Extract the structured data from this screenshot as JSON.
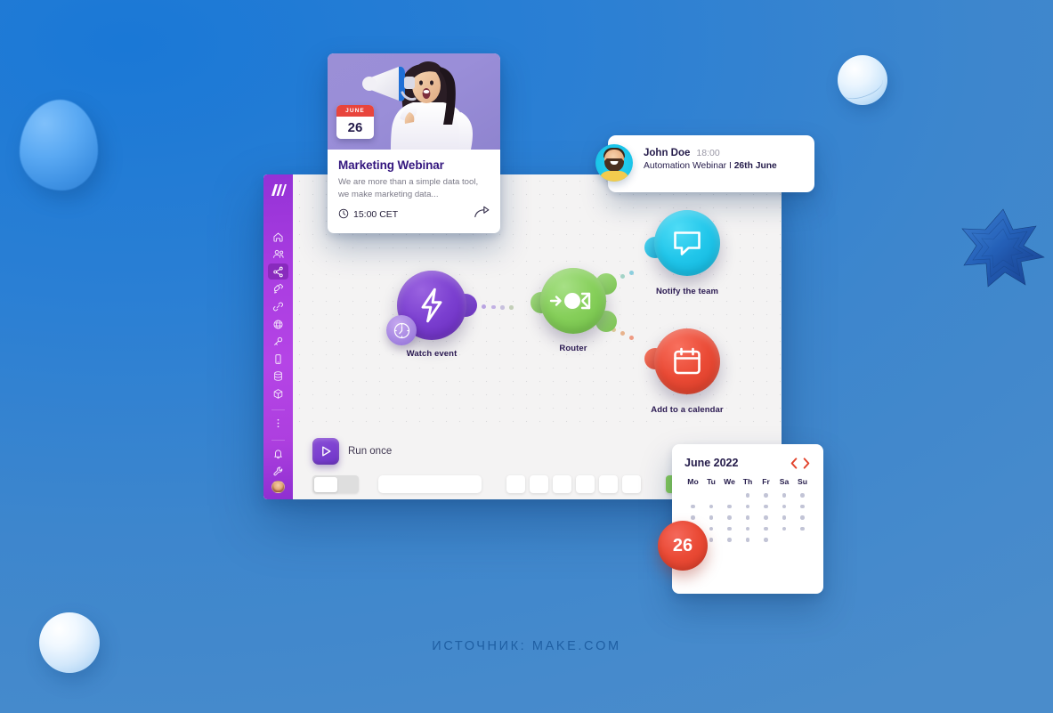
{
  "source_caption": "ИСТОЧНИК: MAKE.COM",
  "app": {
    "brand": "make-logo",
    "sidebar": {
      "items": [
        {
          "icon": "home-icon",
          "name": "sidebar-item-home",
          "active": false
        },
        {
          "icon": "team-icon",
          "name": "sidebar-item-team",
          "active": false
        },
        {
          "icon": "share-nodes-icon",
          "name": "sidebar-item-scenarios",
          "active": true
        },
        {
          "icon": "templates-icon",
          "name": "sidebar-item-templates",
          "active": false
        },
        {
          "icon": "link-icon",
          "name": "sidebar-item-connections",
          "active": false
        },
        {
          "icon": "globe-icon",
          "name": "sidebar-item-webhooks",
          "active": false
        },
        {
          "icon": "key-icon",
          "name": "sidebar-item-keys",
          "active": false
        },
        {
          "icon": "device-icon",
          "name": "sidebar-item-devices",
          "active": false
        },
        {
          "icon": "datastore-icon",
          "name": "sidebar-item-data-stores",
          "active": false
        },
        {
          "icon": "package-icon",
          "name": "sidebar-item-apps",
          "active": false
        }
      ],
      "more_icon": "more-vertical-icon",
      "bottom_items": [
        {
          "icon": "bell-icon",
          "name": "sidebar-item-notifications"
        },
        {
          "icon": "wrench-icon",
          "name": "sidebar-item-tools"
        }
      ],
      "avatar": "user-avatar"
    },
    "canvas": {
      "nodes": [
        {
          "label": "Watch event",
          "color": "#7b3fd0",
          "icon": "lightning-bolt-icon",
          "badge": "clock-icon"
        },
        {
          "label": "Router",
          "color": "#86cf5a",
          "icon": "router-split-icon"
        },
        {
          "label": "Notify the team",
          "color": "#21c6ea",
          "icon": "chat-bubble-icon"
        },
        {
          "label": "Add to a calendar",
          "color": "#ea4a35",
          "icon": "calendar-icon"
        }
      ]
    },
    "toolbar": {
      "run_once_label": "Run once",
      "run_once_icon": "play-icon",
      "swatches": [
        "#86cf5a",
        "#a98df0",
        "#ef5a3f"
      ]
    }
  },
  "webinar_card": {
    "date_month": "JUNE",
    "date_day": "26",
    "title": "Marketing Webinar",
    "description": "We are more than a simple data tool, we make marketing data...",
    "time": "15:00 CET",
    "time_icon": "clock-icon",
    "share_icon": "share-arrow-icon"
  },
  "notification": {
    "name": "John Doe",
    "time": "18:00",
    "text_prefix": "Automation Webinar I ",
    "text_bold": "26th June",
    "avatar": "john-doe-avatar"
  },
  "calendar": {
    "title": "June 2022",
    "prev_icon": "chevron-left-icon",
    "next_icon": "chevron-right-icon",
    "dows": [
      "Mo",
      "Tu",
      "We",
      "Th",
      "Fr",
      "Sa",
      "Su"
    ],
    "selected_day": "26",
    "weeks": [
      [
        0,
        0,
        0,
        1,
        1,
        1,
        1
      ],
      [
        1,
        1,
        1,
        1,
        1,
        1,
        1
      ],
      [
        1,
        1,
        1,
        1,
        1,
        1,
        1
      ],
      [
        1,
        1,
        1,
        1,
        1,
        1,
        1
      ],
      [
        1,
        1,
        1,
        1,
        1,
        0,
        0
      ]
    ]
  }
}
